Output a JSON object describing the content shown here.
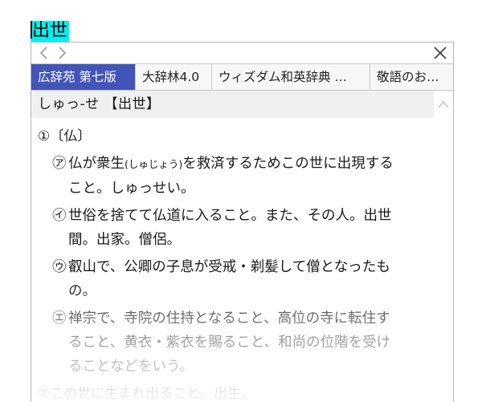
{
  "selection": {
    "text": "出世"
  },
  "nav": {
    "back_icon": "chevron-left-icon",
    "forward_icon": "chevron-right-icon",
    "close_icon": "close-icon"
  },
  "tabs": [
    {
      "label": "広辞苑 第七版",
      "active": true
    },
    {
      "label": "大辞林4.0",
      "active": false
    },
    {
      "label": "ウィズダム和英辞典 …",
      "active": false
    },
    {
      "label": "敬語のお辞典",
      "active": false
    }
  ],
  "entry": {
    "headword": "しゅっ‐せ 【出世】",
    "sense1": {
      "label": "①〔仏〕",
      "subs": [
        {
          "mark": "㋐",
          "line1_a": "仏が衆生",
          "reading": "(しゅじょう)",
          "line1_b": "を救済するためこの世に出現する",
          "line2": "こと。しゅっせい。"
        },
        {
          "mark": "㋑",
          "line1": "世俗を捨てて仏道に入ること。また、その人。出世",
          "line2": "間。出家。僧侶。"
        },
        {
          "mark": "㋒",
          "line1": "叡山で、公卿の子息が受戒・剃髪して僧となったも",
          "line2": "の。"
        },
        {
          "mark": "㋓",
          "line1": "禅宗で、寺院の住持となること、高位の寺に転住す",
          "line2": "ること、黄衣・紫衣を賜ること、和尚の位階を受け",
          "line3": "ることなどをいう。"
        }
      ]
    },
    "sense2": {
      "label": "②この世に生まれ出ること。出生。"
    }
  }
}
